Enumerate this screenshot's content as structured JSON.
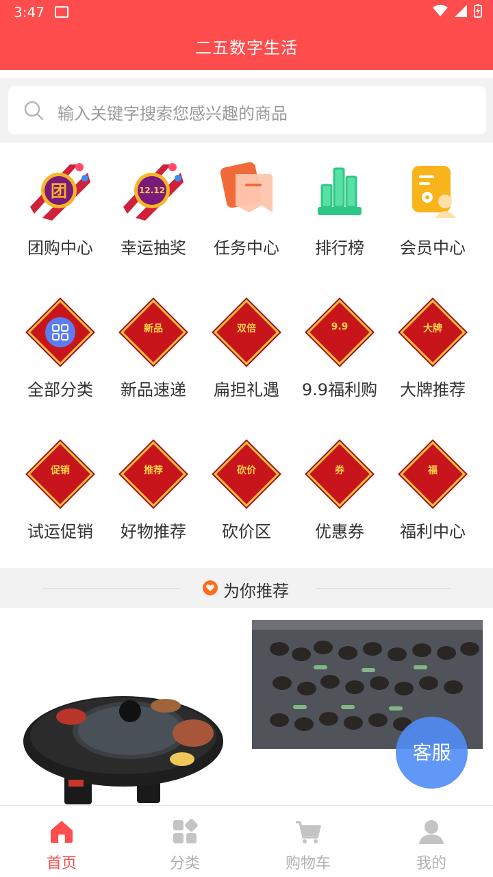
{
  "status_bar": {
    "time": "3:47"
  },
  "app_title": "二五数字生活",
  "search": {
    "placeholder": "输入关键字搜索您感兴趣的商品"
  },
  "grid_items": [
    {
      "label": "团购中心",
      "badge": "团"
    },
    {
      "label": "幸运抽奖",
      "badge": "12.12"
    },
    {
      "label": "任务中心"
    },
    {
      "label": "排行榜"
    },
    {
      "label": "会员中心"
    },
    {
      "label": "全部分类"
    },
    {
      "label": "新品速递",
      "badge": "新品"
    },
    {
      "label": "扁担礼遇",
      "badge": "双倍"
    },
    {
      "label": "9.9福利购",
      "badge": "9.9"
    },
    {
      "label": "大牌推荐",
      "badge": "大牌"
    },
    {
      "label": "试运促销",
      "badge": "促销"
    },
    {
      "label": "好物推荐",
      "badge": "推荐"
    },
    {
      "label": "砍价区",
      "badge": "砍价"
    },
    {
      "label": "优惠券",
      "badge": "券"
    },
    {
      "label": "福利中心",
      "badge": "福"
    }
  ],
  "recommend": {
    "title": "为你推荐"
  },
  "floating": {
    "customer_service": "客服"
  },
  "tabbar": [
    {
      "label": "首页",
      "icon": "home-icon",
      "active": true
    },
    {
      "label": "分类",
      "icon": "category-icon",
      "active": false
    },
    {
      "label": "购物车",
      "icon": "cart-icon",
      "active": false
    },
    {
      "label": "我的",
      "icon": "user-icon",
      "active": false
    }
  ],
  "colors": {
    "brand": "#ff4c4c",
    "active_tab": "#ff4c4c",
    "inactive_tab": "#b0b0b0",
    "kefu": "#508cf5"
  }
}
